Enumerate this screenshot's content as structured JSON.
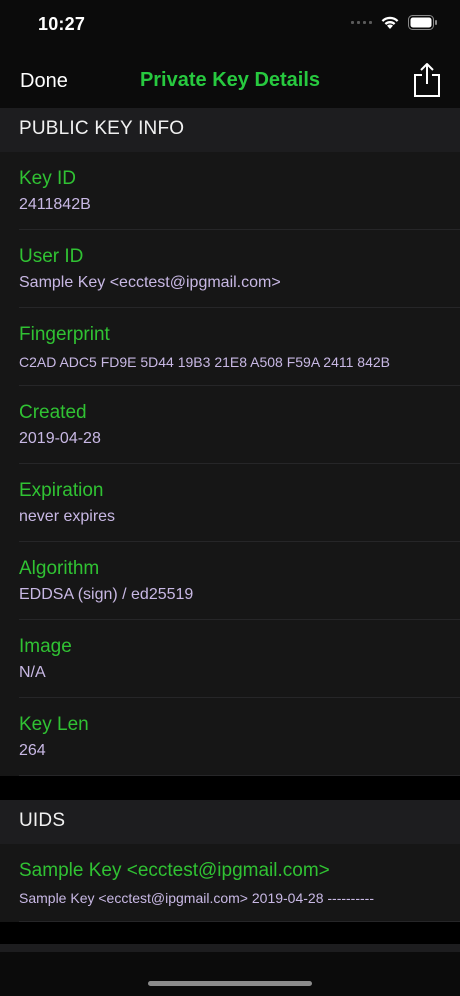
{
  "status_bar": {
    "time": "10:27",
    "icons": [
      "signal-dots-icon",
      "wifi-icon",
      "battery-icon"
    ]
  },
  "nav": {
    "done_label": "Done",
    "title": "Private Key Details",
    "share_icon": "share-icon"
  },
  "colors": {
    "accent_green": "#30c233",
    "title_green": "#27c93f",
    "value_lavender": "#c8b8e4",
    "header_bg": "#1d1d1f",
    "row_bg": "#161616"
  },
  "sections": {
    "public_key_info": {
      "header": "PUBLIC KEY INFO",
      "rows": [
        {
          "label": "Key ID",
          "value": "2411842B"
        },
        {
          "label": "User ID",
          "value": "Sample Key <ecctest@ipgmail.com>"
        },
        {
          "label": "Fingerprint",
          "value": "C2AD ADC5 FD9E 5D44 19B3 21E8 A508 F59A 2411 842B"
        },
        {
          "label": "Created",
          "value": "2019-04-28"
        },
        {
          "label": "Expiration",
          "value": "never expires"
        },
        {
          "label": "Algorithm",
          "value": "EDDSA (sign) / ed25519"
        },
        {
          "label": "Image",
          "value": "N/A"
        },
        {
          "label": "Key Len",
          "value": "264"
        }
      ]
    },
    "uids": {
      "header": "UIDS",
      "rows": [
        {
          "label": "Sample Key <ecctest@ipgmail.com>",
          "value": "Sample Key <ecctest@ipgmail.com> 2019-04-28 ----------"
        }
      ]
    }
  }
}
